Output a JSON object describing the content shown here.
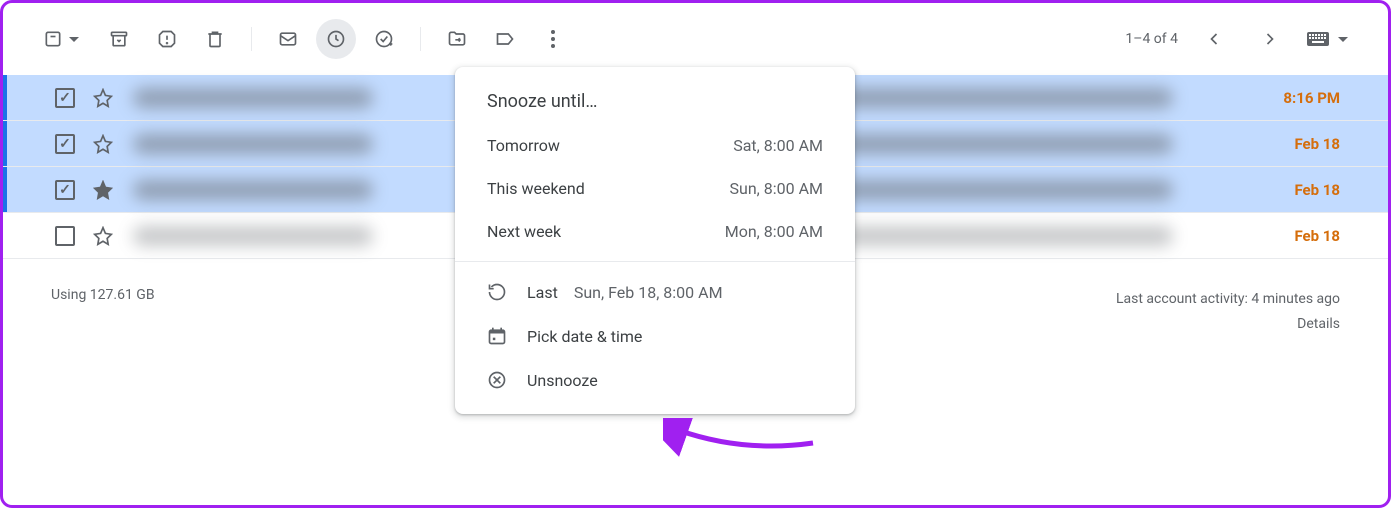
{
  "toolbar": {
    "pager_text": "1–4 of 4"
  },
  "rows": [
    {
      "selected": true,
      "starred": false,
      "time": "8:16 PM"
    },
    {
      "selected": true,
      "starred": false,
      "time": "Feb 18"
    },
    {
      "selected": true,
      "starred": true,
      "time": "Feb 18"
    },
    {
      "selected": false,
      "starred": false,
      "time": "Feb 18"
    }
  ],
  "popup": {
    "title": "Snooze until…",
    "tomorrow_label": "Tomorrow",
    "tomorrow_detail": "Sat, 8:00 AM",
    "weekend_label": "This weekend",
    "weekend_detail": "Sun, 8:00 AM",
    "nextweek_label": "Next week",
    "nextweek_detail": "Mon, 8:00 AM",
    "last_label": "Last",
    "last_detail": "Sun, Feb 18, 8:00 AM",
    "pick_label": "Pick date & time",
    "unsnooze_label": "Unsnooze"
  },
  "footer": {
    "storage": "Using 127.61 GB",
    "activity": "Last account activity: 4 minutes ago",
    "details": "Details"
  }
}
